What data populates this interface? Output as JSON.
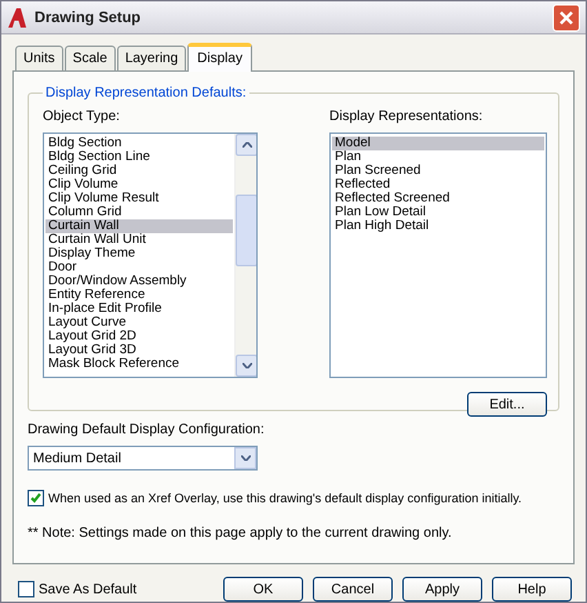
{
  "window": {
    "title": "Drawing Setup"
  },
  "tabs": [
    {
      "label": "Units",
      "selected": false
    },
    {
      "label": "Scale",
      "selected": false
    },
    {
      "label": "Layering",
      "selected": false
    },
    {
      "label": "Display",
      "selected": true
    }
  ],
  "group": {
    "title": "Display Representation Defaults:"
  },
  "object_types": {
    "label": "Object Type:",
    "items": [
      {
        "label": "Bldg Section",
        "selected": false
      },
      {
        "label": "Bldg Section Line",
        "selected": false
      },
      {
        "label": "Ceiling Grid",
        "selected": false
      },
      {
        "label": "Clip Volume",
        "selected": false
      },
      {
        "label": "Clip Volume Result",
        "selected": false
      },
      {
        "label": "Column Grid",
        "selected": false
      },
      {
        "label": "Curtain Wall",
        "selected": true
      },
      {
        "label": "Curtain Wall Unit",
        "selected": false
      },
      {
        "label": "Display Theme",
        "selected": false
      },
      {
        "label": "Door",
        "selected": false
      },
      {
        "label": "Door/Window Assembly",
        "selected": false
      },
      {
        "label": "Entity Reference",
        "selected": false
      },
      {
        "label": "In-place Edit Profile",
        "selected": false
      },
      {
        "label": "Layout Curve",
        "selected": false
      },
      {
        "label": "Layout Grid 2D",
        "selected": false
      },
      {
        "label": "Layout Grid 3D",
        "selected": false
      },
      {
        "label": "Mask Block Reference",
        "selected": false
      }
    ]
  },
  "display_representations": {
    "label": "Display Representations:",
    "items": [
      {
        "label": "Model",
        "selected": true
      },
      {
        "label": "Plan",
        "selected": false
      },
      {
        "label": "Plan Screened",
        "selected": false
      },
      {
        "label": "Reflected",
        "selected": false
      },
      {
        "label": "Reflected Screened",
        "selected": false
      },
      {
        "label": "Plan Low Detail",
        "selected": false
      },
      {
        "label": "Plan High Detail",
        "selected": false
      }
    ]
  },
  "edit_button": "Edit...",
  "configuration": {
    "label": "Drawing Default Display Configuration:",
    "value": "Medium Detail"
  },
  "xref_option": {
    "label": "When used as an Xref Overlay, use this drawing's default display configuration initially.",
    "checked": true
  },
  "note": "** Note: Settings made on this page apply to the current drawing only.",
  "save_as_default": {
    "label": "Save As Default",
    "checked": false
  },
  "buttons": [
    "OK",
    "Cancel",
    "Apply",
    "Help"
  ]
}
